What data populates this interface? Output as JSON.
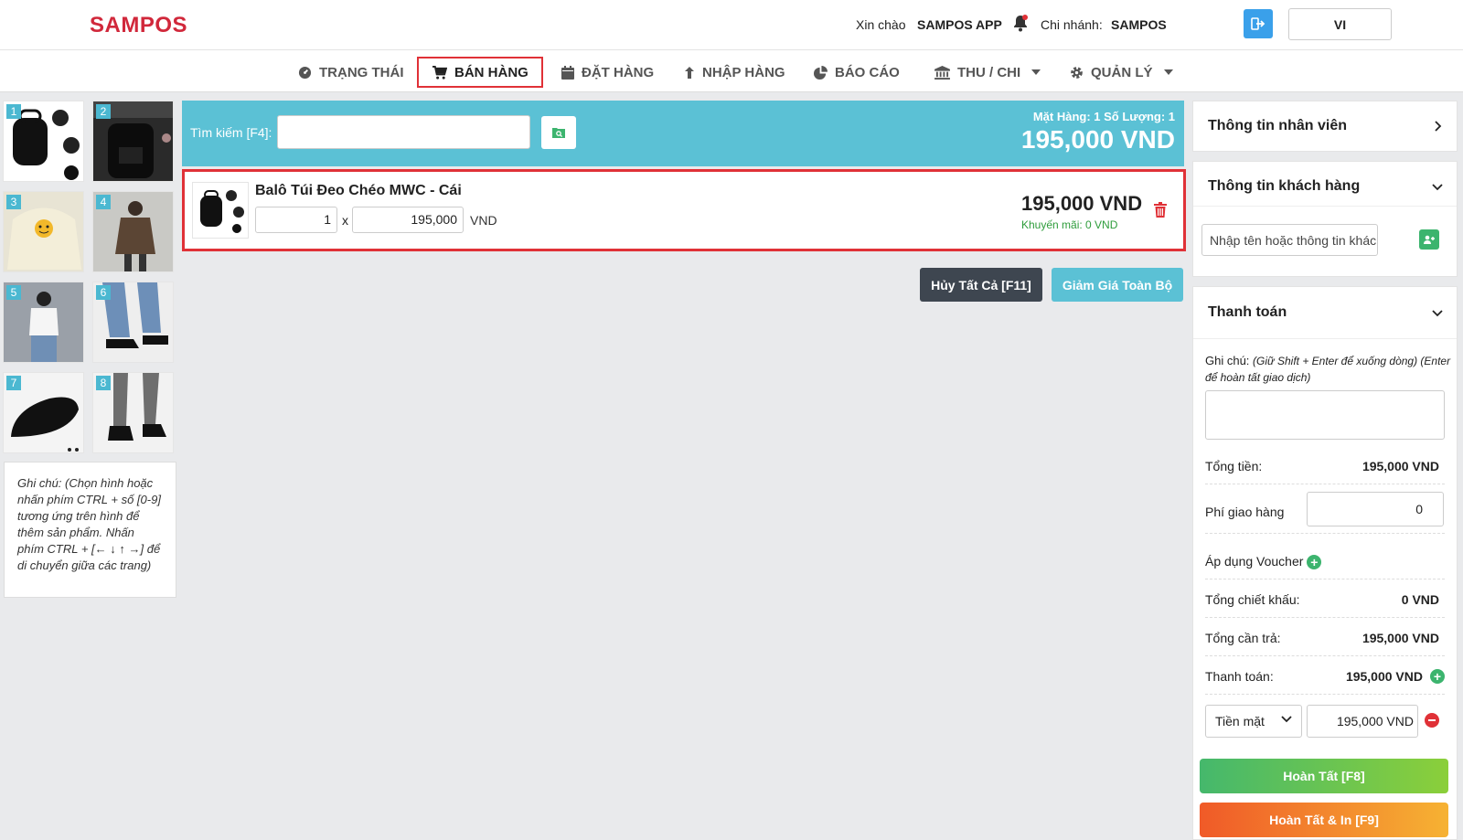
{
  "header": {
    "logo": "SAMPOS",
    "greeting": "Xin chào",
    "user_name": "SAMPOS APP",
    "branch_label": "Chi nhánh:",
    "branch_name": "SAMPOS",
    "language": "VI"
  },
  "nav": {
    "items": [
      {
        "label": "TRẠNG THÁI",
        "icon": "dashboard-icon"
      },
      {
        "label": "BÁN HÀNG",
        "icon": "cart-icon",
        "active": true
      },
      {
        "label": "ĐẶT HÀNG",
        "icon": "calendar-icon"
      },
      {
        "label": "NHẬP HÀNG",
        "icon": "arrow-up-icon"
      },
      {
        "label": "BÁO CÁO",
        "icon": "pie-chart-icon"
      },
      {
        "label": "THU / CHI",
        "icon": "bank-icon",
        "dropdown": true
      },
      {
        "label": "QUẢN LÝ",
        "icon": "gear-icon",
        "dropdown": true
      }
    ]
  },
  "products": [
    {
      "num": "1",
      "desc": "black backpack"
    },
    {
      "num": "2",
      "desc": "black backpack banner"
    },
    {
      "num": "3",
      "desc": "cream smiley hoodie"
    },
    {
      "num": "4",
      "desc": "brown jacket"
    },
    {
      "num": "5",
      "desc": "woman in white tee"
    },
    {
      "num": "6",
      "desc": "black heeled mules"
    },
    {
      "num": "7",
      "desc": "black slide sandal"
    },
    {
      "num": "8",
      "desc": "black loafers"
    }
  ],
  "product_note": "Ghi chú: (Chọn hình hoặc nhấn phím CTRL + số [0-9] tương ứng trên hình để thêm sản phẩm. Nhấn phím CTRL + [← ↓ ↑ →] để di chuyển giữa các trang)",
  "search": {
    "label": "Tìm kiếm [F4]:",
    "placeholder": "",
    "counts": "Mặt Hàng:  1   Số Lượng:  1",
    "total": "195,000 VND"
  },
  "cart": {
    "items": [
      {
        "name": "Balô Túi Đeo Chéo MWC - Cái",
        "qty": "1",
        "times": "x",
        "price": "195,000",
        "unit": "VND",
        "total": "195,000 VND",
        "promo": "Khuyến mãi: 0 VND"
      }
    ],
    "cancel_all": "Hủy Tất Cả [F11]",
    "discount_all": "Giảm Giá Toàn Bộ"
  },
  "right": {
    "staff_title": "Thông tin nhân viên",
    "customer_title": "Thông tin khách hàng",
    "customer_placeholder": "Nhập tên hoặc thông tin khác",
    "payment_title": "Thanh toán",
    "note_label": "Ghi chú:",
    "note_hint": "(Giữ Shift + Enter để xuống dòng) (Enter để hoàn tất giao dịch)",
    "rows": {
      "subtotal_label": "Tổng tiền:",
      "subtotal_value": "195,000 VND",
      "shipping_label": "Phí giao hàng",
      "shipping_value": "0",
      "voucher_label": "Áp dụng Voucher",
      "discount_label": "Tổng chiết khấu:",
      "discount_value": "0 VND",
      "due_label": "Tổng cần trả:",
      "due_value": "195,000 VND",
      "paid_label": "Thanh toán:",
      "paid_value": "195,000 VND"
    },
    "method": "Tiền mặt",
    "amount": "195,000  VND",
    "done": "Hoàn Tất [F8]",
    "done_print": "Hoàn Tất & In [F9]"
  },
  "colors": {
    "brand": "#d1283b",
    "teal": "#5bc1d5",
    "green": "#3cb46e",
    "red": "#e03137"
  }
}
